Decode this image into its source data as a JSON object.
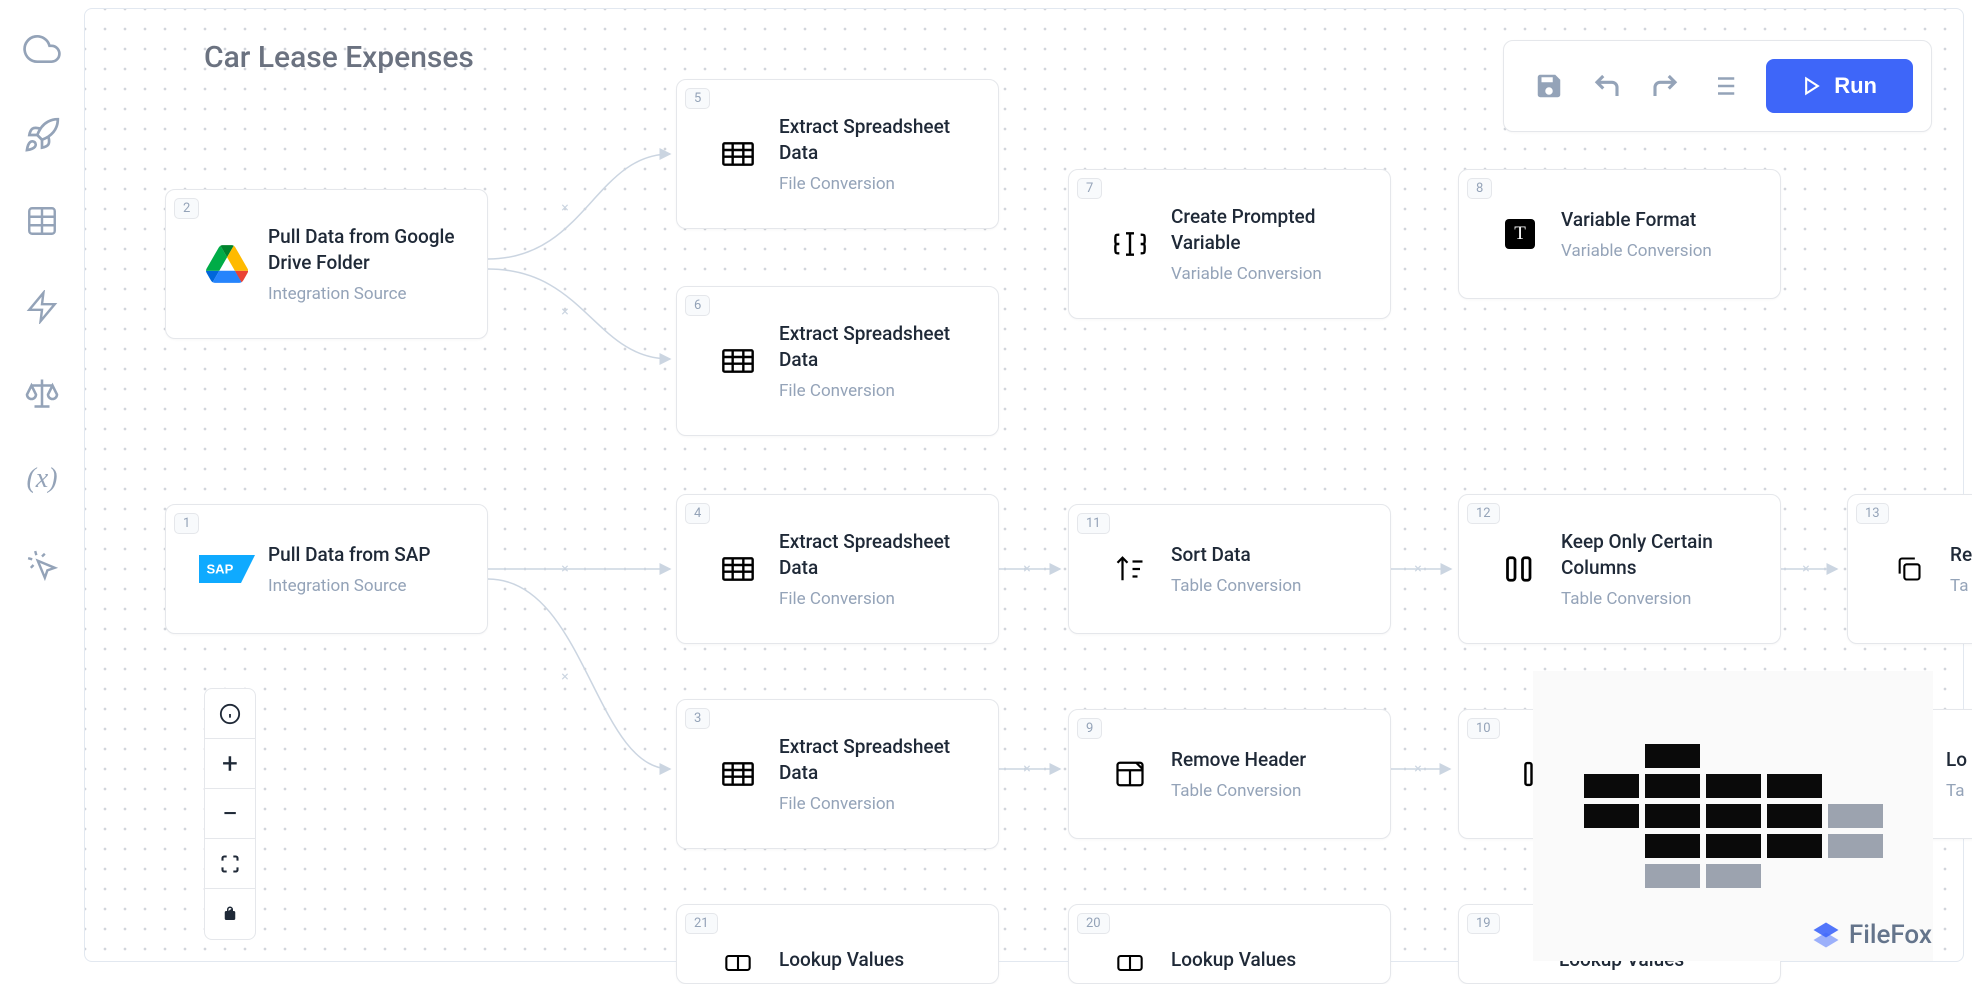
{
  "title": "Car Lease Expenses",
  "toolbar": {
    "run_label": "Run"
  },
  "sidebar": {
    "items": [
      "cloud",
      "rocket",
      "table",
      "bolt",
      "scales",
      "variable",
      "cursor"
    ]
  },
  "nodes": [
    {
      "id": "2",
      "title": "Pull Data from Google Drive Folder",
      "sub": "Integration Source",
      "icon": "gdrive"
    },
    {
      "id": "5",
      "title": "Extract Spreadsheet Data",
      "sub": "File Conversion",
      "icon": "sheet"
    },
    {
      "id": "6",
      "title": "Extract Spreadsheet Data",
      "sub": "File Conversion",
      "icon": "sheet"
    },
    {
      "id": "7",
      "title": "Create Prompted Variable",
      "sub": "Variable Conversion",
      "icon": "prompt"
    },
    {
      "id": "8",
      "title": "Variable Format",
      "sub": "Variable Conversion",
      "icon": "format"
    },
    {
      "id": "1",
      "title": "Pull Data from SAP",
      "sub": "Integration Source",
      "icon": "sap"
    },
    {
      "id": "4",
      "title": "Extract Spreadsheet Data",
      "sub": "File Conversion",
      "icon": "sheet"
    },
    {
      "id": "11",
      "title": "Sort Data",
      "sub": "Table Conversion",
      "icon": "sort"
    },
    {
      "id": "12",
      "title": "Keep Only Certain Columns",
      "sub": "Table Conversion",
      "icon": "columns"
    },
    {
      "id": "13",
      "title": "Re",
      "sub": "Ta",
      "icon": "copy"
    },
    {
      "id": "3",
      "title": "Extract Spreadsheet Data",
      "sub": "File Conversion",
      "icon": "sheet"
    },
    {
      "id": "9",
      "title": "Remove Header",
      "sub": "Table Conversion",
      "icon": "header"
    },
    {
      "id": "10",
      "title": "",
      "sub": "",
      "icon": "addcol"
    },
    {
      "id": "lo1",
      "title": "Lo",
      "sub": "Ta",
      "icon": ""
    },
    {
      "id": "21",
      "title": "Lookup Values",
      "sub": "",
      "icon": "lookup"
    },
    {
      "id": "20",
      "title": "Lookup Values",
      "sub": "",
      "icon": "lookup"
    },
    {
      "id": "19",
      "title": "Lookup Values",
      "sub": "",
      "icon": "lookup"
    }
  ],
  "brand": "FileFox",
  "chart_data": {
    "type": "heatmap",
    "title": "",
    "rows": 5,
    "cols": 5,
    "cells": [
      [
        null,
        "dark",
        null,
        null,
        null
      ],
      [
        "dark",
        "dark",
        "dark",
        "dark",
        null
      ],
      [
        "dark",
        "dark",
        "dark",
        "dark",
        "light"
      ],
      [
        null,
        "dark",
        "dark",
        "dark",
        "light"
      ],
      [
        null,
        "light",
        "light",
        null,
        null
      ]
    ],
    "colors": {
      "dark": "#0a0a0a",
      "light": "#9ca3af",
      "empty": "transparent"
    }
  }
}
